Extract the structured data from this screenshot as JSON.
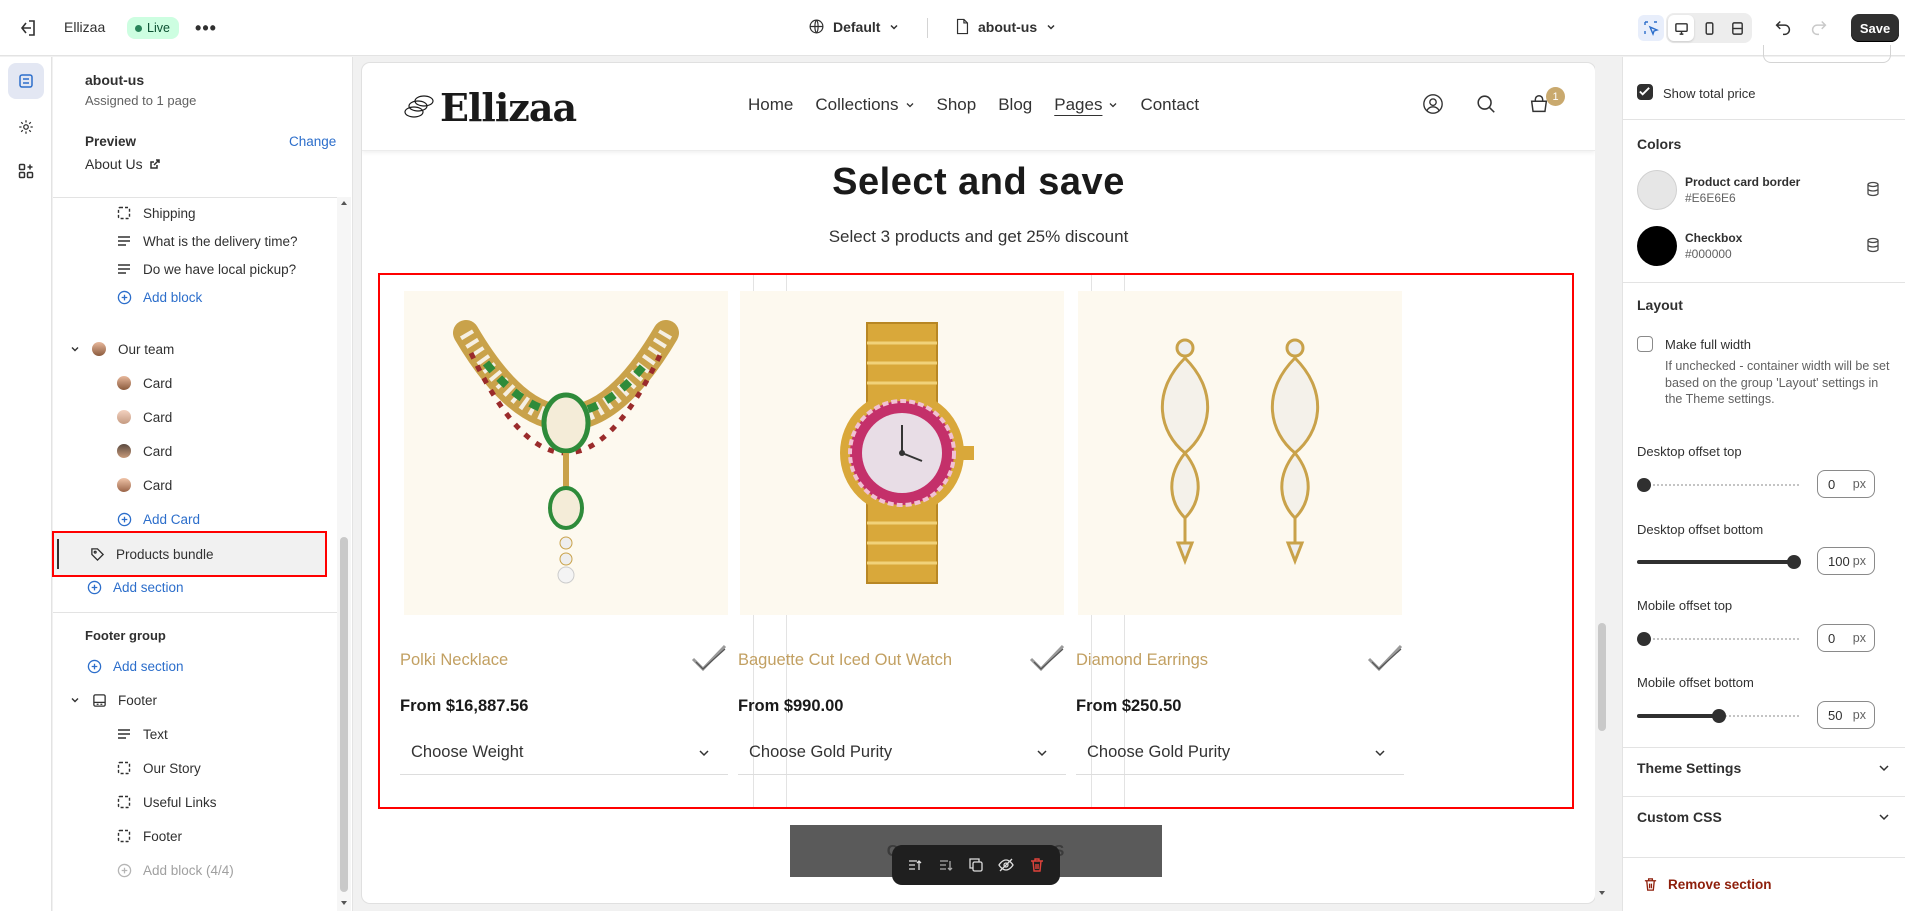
{
  "topbar": {
    "store_name": "Ellizaa",
    "status": "Live",
    "theme_selector": "Default",
    "template_selector": "about-us",
    "save_label": "Save"
  },
  "left_panel": {
    "template_name": "about-us",
    "assigned": "Assigned to 1 page",
    "preview_label": "Preview",
    "change_label": "Change",
    "preview_page": "About Us",
    "items": [
      {
        "label": "Shipping",
        "icon": "section-icon"
      },
      {
        "label": "What is the delivery time?",
        "icon": "text-lines-icon"
      },
      {
        "label": "Do we have local pickup?",
        "icon": "text-lines-icon"
      },
      {
        "label": "Add block",
        "icon": "plus-circle-icon"
      },
      {
        "label": "Our team",
        "icon": "team-avatar-icon"
      },
      {
        "label": "Card",
        "icon": "avatar-icon"
      },
      {
        "label": "Card",
        "icon": "avatar-icon"
      },
      {
        "label": "Card",
        "icon": "avatar-icon"
      },
      {
        "label": "Card",
        "icon": "avatar-icon"
      },
      {
        "label": "Add Card",
        "icon": "plus-circle-icon"
      },
      {
        "label": "Products bundle",
        "icon": "tag-icon"
      },
      {
        "label": "Add section",
        "icon": "plus-circle-icon"
      }
    ],
    "footer_group": {
      "title": "Footer group",
      "add_section": "Add section",
      "footer": "Footer",
      "children": [
        "Text",
        "Our Story",
        "Useful Links",
        "Footer"
      ],
      "add_block": "Add block (4/4)"
    }
  },
  "preview": {
    "logo": "Ellizaa",
    "nav": [
      "Home",
      "Collections",
      "Shop",
      "Blog",
      "Pages",
      "Contact"
    ],
    "cart_count": "1",
    "title": "Select and save",
    "subtitle": "Select 3 products and get 25% discount",
    "products": [
      {
        "name": "Polki Necklace",
        "price": "From $16,887.56",
        "option": "Choose Weight"
      },
      {
        "name": "Baguette Cut Iced Out Watch",
        "price": "From $990.00",
        "option": "Choose Gold Purity"
      },
      {
        "name": "Diamond Earrings",
        "price": "From $250.50",
        "option": "Choose Gold Purity"
      }
    ],
    "plus_sign": "+",
    "choose_button": "CHOOSE PRODUCTS"
  },
  "right_panel": {
    "show_total_price": "Show total price",
    "colors_title": "Colors",
    "border_color_name": "Product card border",
    "border_color_hex": "#E6E6E6",
    "checkbox_color_name": "Checkbox",
    "checkbox_color_hex": "#000000",
    "layout_title": "Layout",
    "full_width_label": "Make full width",
    "full_width_help": "If unchecked - container width will be set based on the group 'Layout' settings in the Theme settings.",
    "desktop_top_label": "Desktop offset top",
    "desktop_top_value": "0",
    "desktop_bottom_label": "Desktop offset bottom",
    "desktop_bottom_value": "100",
    "mobile_top_label": "Mobile offset top",
    "mobile_top_value": "0",
    "mobile_bottom_label": "Mobile offset bottom",
    "mobile_bottom_value": "50",
    "unit": "px",
    "theme_settings": "Theme Settings",
    "custom_css": "Custom CSS",
    "remove_section": "Remove section"
  },
  "colors": {
    "accent": "#2C6ECB",
    "selection_outline": "#FF0000",
    "product_name": "#C2A062",
    "live_badge_bg": "#CDFEE1"
  }
}
